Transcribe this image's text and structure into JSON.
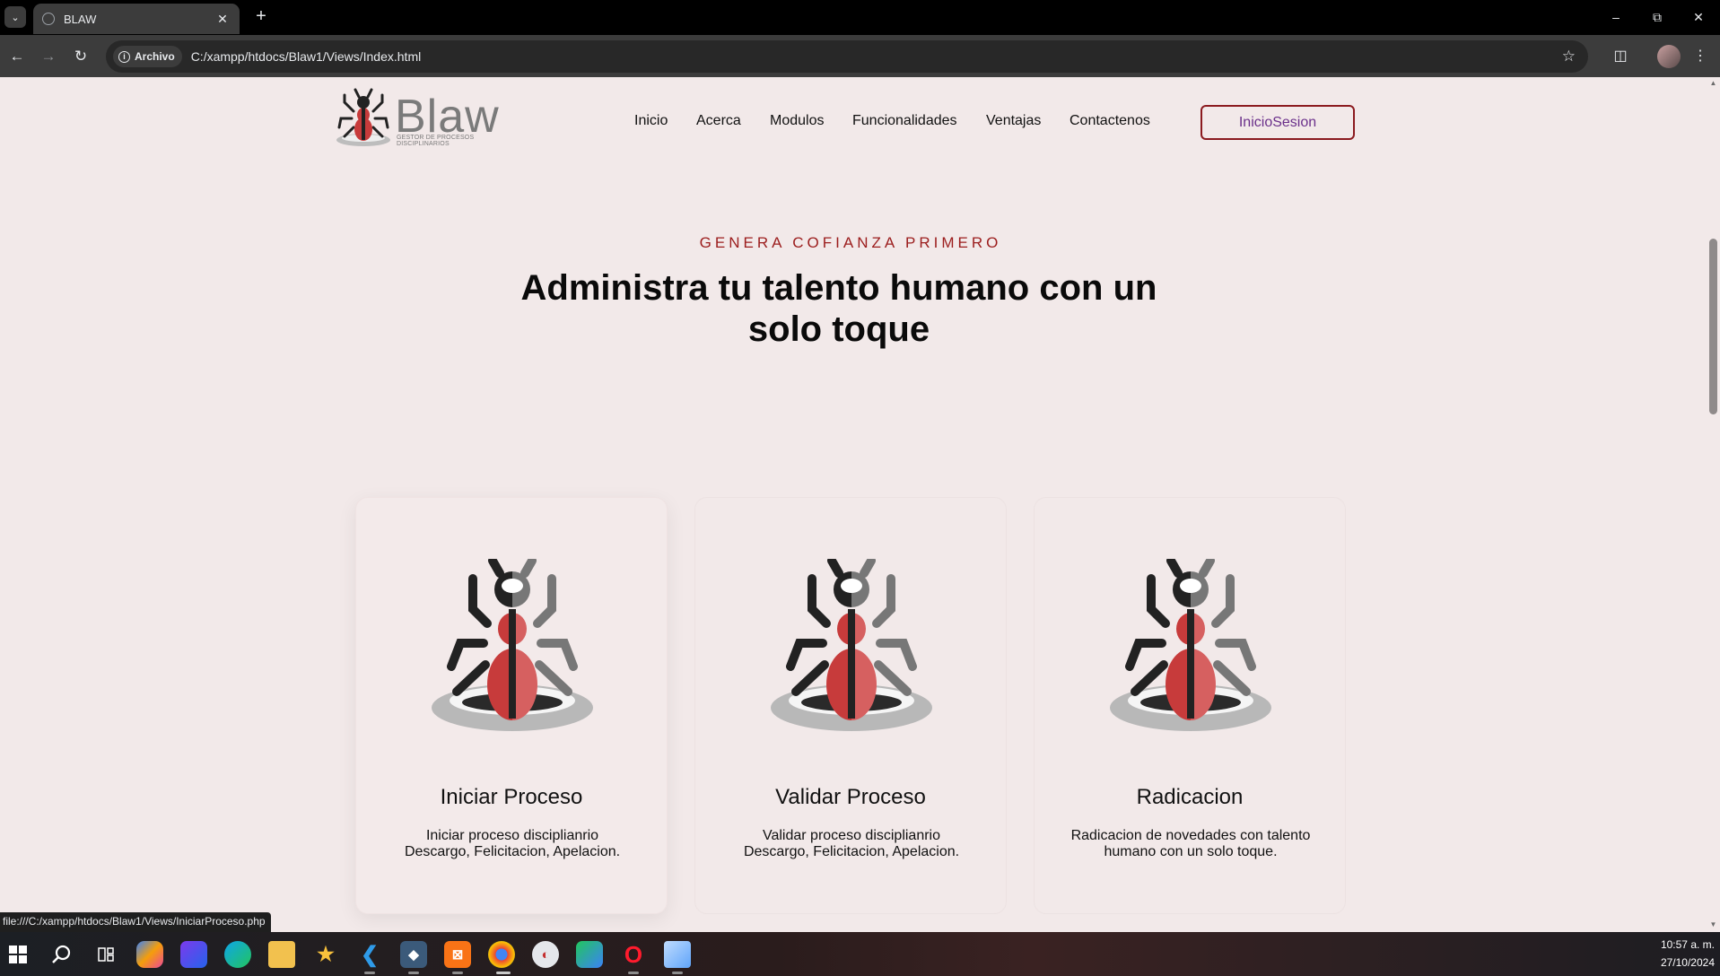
{
  "browser": {
    "tab_title": "BLAW",
    "chip_label": "Archivo",
    "url": "C:/xampp/htdocs/Blaw1/Views/Index.html",
    "status_url": "file:///C:/xampp/htdocs/Blaw1/Views/IniciarProceso.php"
  },
  "site": {
    "logo_text": "Blaw",
    "logo_subtitle": "GESTOR DE PROCESOS DISCIPLINARIOS",
    "menu": [
      "Inicio",
      "Acerca",
      "Modulos",
      "Funcionalidades",
      "Ventajas",
      "Contactenos"
    ],
    "login_label": "InicioSesion",
    "eyebrow": "GENERA COFIANZA PRIMERO",
    "headline": "Administra tu talento humano con un solo toque"
  },
  "cards": [
    {
      "title": "Iniciar Proceso",
      "text": "Iniciar proceso disciplianrio Descargo, Felicitacion, Apelacion."
    },
    {
      "title": "Validar Proceso",
      "text": "Validar proceso disciplianrio Descargo, Felicitacion, Apelacion."
    },
    {
      "title": "Radicacion",
      "text": "Radicacion de novedades con talento humano con un solo toque."
    }
  ],
  "taskbar": {
    "time": "10:57 a. m.",
    "date": "27/10/2024"
  },
  "colors": {
    "page_bg": "#f2e9e9",
    "accent_red": "#9b1c1c",
    "login_border": "#8b1a1f",
    "login_text": "#6a2f8a"
  }
}
